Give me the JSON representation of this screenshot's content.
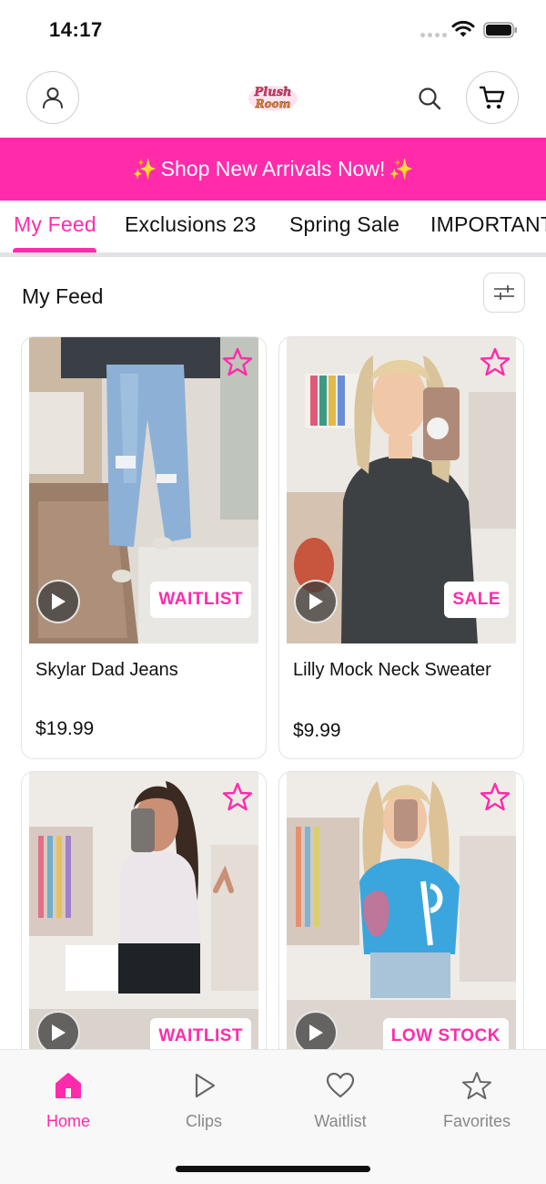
{
  "status_bar": {
    "time": "14:17"
  },
  "header": {
    "logo_text": "Plush Room",
    "account_icon": "person-icon",
    "search_icon": "search-icon",
    "cart_icon": "cart-icon"
  },
  "promo_banner": {
    "text": "Shop New Arrivals Now!",
    "sparkle": "✨"
  },
  "tabs": [
    {
      "label": "My Feed",
      "active": true
    },
    {
      "label": "Exclusions 23"
    },
    {
      "label": "Spring Sale"
    },
    {
      "label": "IMPORTANT"
    }
  ],
  "feed": {
    "title": "My Feed",
    "filter_icon": "sliders-icon"
  },
  "products": [
    {
      "name": "Skylar Dad Jeans",
      "price": "$19.99",
      "badge": "WAITLIST"
    },
    {
      "name": "Lilly Mock Neck Sweater",
      "price": "$9.99",
      "badge": "SALE"
    },
    {
      "name": "",
      "price": "",
      "badge": "WAITLIST"
    },
    {
      "name": "",
      "price": "",
      "badge": "LOW STOCK"
    }
  ],
  "bottom_nav": [
    {
      "label": "Home",
      "icon": "home-icon",
      "active": true
    },
    {
      "label": "Clips",
      "icon": "play-icon"
    },
    {
      "label": "Waitlist",
      "icon": "heart-icon"
    },
    {
      "label": "Favorites",
      "icon": "star-icon"
    }
  ],
  "colors": {
    "accent": "#ff2bab",
    "sparkle": "#ffd84a"
  }
}
